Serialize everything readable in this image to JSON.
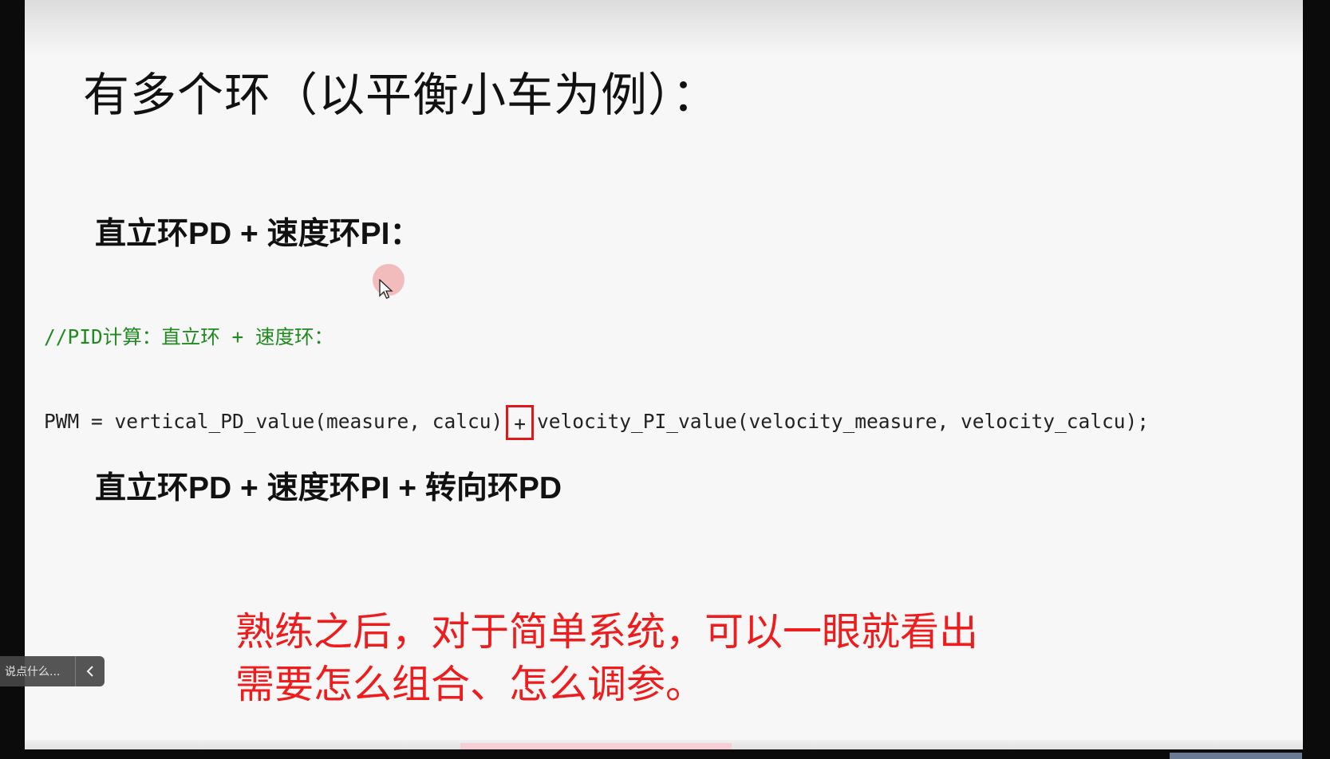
{
  "slide": {
    "title": "有多个环（以平衡小车为例）：",
    "heading_1": "直立环PD + 速度环PI：",
    "code_comment": "//PID计算：直立环 + 速度环：",
    "code_line_left": "PWM = vertical_PD_value(measure, calcu)",
    "code_line_op": "+",
    "code_line_right": "velocity_PI_value(velocity_measure, velocity_calcu);",
    "heading_2": "直立环PD + 速度环PI + 转向环PD",
    "tip_line_1": "熟练之后，对于简单系统，可以一眼就看出",
    "tip_line_2": "需要怎么组合、怎么调参。"
  },
  "danmaku": {
    "placeholder": "说点什么...",
    "collapse_icon": "chevron-left-icon"
  },
  "colors": {
    "slide_bg": "#f7f7f7",
    "comment": "#1f8a1f",
    "highlight_border": "#e0171b",
    "tip_text": "#ee1c1c",
    "frame_bg": "#0b0b0b"
  }
}
